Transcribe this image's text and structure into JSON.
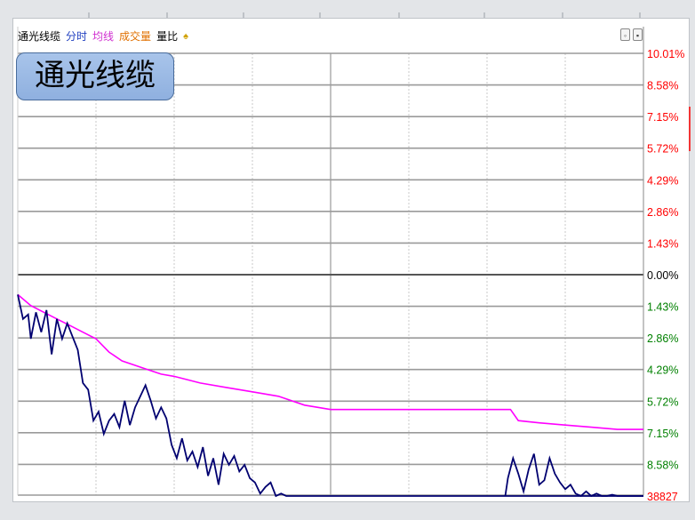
{
  "header": {
    "stock_label": "通光线缆",
    "time_label": "分时",
    "avg_label": "均线",
    "volume_label": "成交量",
    "ratio_label": "量比",
    "bell_icon": "bell-icon",
    "zoom_icon": "zoom-icon",
    "menu_icon": "menu-icon"
  },
  "title_badge": "通光线缆",
  "bottom_right_value": "38827",
  "colors": {
    "price_line": "#000070",
    "avg_line": "#ff00ff",
    "positive": "#ff0000",
    "negative": "#008000",
    "baseline": "#000000"
  },
  "chart_data": {
    "type": "line",
    "title": "",
    "xlabel": "",
    "ylabel": "",
    "y_ticks_right": [
      {
        "label": "10.01%",
        "value": 10.01,
        "sign": "up"
      },
      {
        "label": "8.58%",
        "value": 8.58,
        "sign": "up"
      },
      {
        "label": "7.15%",
        "value": 7.15,
        "sign": "up"
      },
      {
        "label": "5.72%",
        "value": 5.72,
        "sign": "up"
      },
      {
        "label": "4.29%",
        "value": 4.29,
        "sign": "up"
      },
      {
        "label": "2.86%",
        "value": 2.86,
        "sign": "up"
      },
      {
        "label": "1.43%",
        "value": 1.43,
        "sign": "up"
      },
      {
        "label": "0.00%",
        "value": 0.0,
        "sign": "zero"
      },
      {
        "label": "1.43%",
        "value": -1.43,
        "sign": "down"
      },
      {
        "label": "2.86%",
        "value": -2.86,
        "sign": "down"
      },
      {
        "label": "4.29%",
        "value": -4.29,
        "sign": "down"
      },
      {
        "label": "5.72%",
        "value": -5.72,
        "sign": "down"
      },
      {
        "label": "7.15%",
        "value": -7.15,
        "sign": "down"
      },
      {
        "label": "8.58%",
        "value": -8.58,
        "sign": "down"
      }
    ],
    "ylim": [
      -10.01,
      10.01
    ],
    "xlim": [
      0,
      240
    ],
    "grid": true,
    "series": [
      {
        "key": "price",
        "x": [
          0,
          2,
          4,
          5,
          7,
          9,
          11,
          13,
          15,
          17,
          19,
          21,
          23,
          25,
          27,
          29,
          31,
          33,
          35,
          37,
          39,
          41,
          43,
          45,
          47,
          49,
          51,
          53,
          55,
          57,
          59,
          61,
          63,
          65,
          67,
          69,
          71,
          73,
          75,
          77,
          79,
          81,
          83,
          85,
          87,
          89,
          91,
          93,
          95,
          97,
          99,
          101,
          103,
          105,
          107,
          110,
          240
        ],
        "values": [
          -0.9,
          -2.0,
          -1.8,
          -2.9,
          -1.7,
          -2.6,
          -1.6,
          -3.6,
          -2.0,
          -2.9,
          -2.2,
          -2.8,
          -3.4,
          -4.9,
          -5.2,
          -6.6,
          -6.2,
          -7.2,
          -6.6,
          -6.3,
          -6.9,
          -5.7,
          -6.8,
          -6.0,
          -5.5,
          -5.0,
          -5.7,
          -6.5,
          -6.0,
          -6.5,
          -7.7,
          -8.3,
          -7.4,
          -8.4,
          -8.0,
          -8.7,
          -7.8,
          -9.1,
          -8.3,
          -9.5,
          -8.1,
          -8.6,
          -8.2,
          -8.9,
          -8.6,
          -9.2,
          -9.4,
          -9.9,
          -9.6,
          -9.4,
          -10.01,
          -9.9,
          -10.01,
          -10.01,
          -10.01,
          -10.01,
          -10.01
        ]
      },
      {
        "key": "avg",
        "x": [
          0,
          5,
          10,
          15,
          20,
          25,
          30,
          35,
          40,
          45,
          50,
          55,
          60,
          70,
          80,
          90,
          100,
          110,
          120,
          150,
          165,
          180,
          189,
          192,
          200,
          210,
          220,
          230,
          240
        ],
        "values": [
          -0.9,
          -1.4,
          -1.7,
          -2.0,
          -2.3,
          -2.6,
          -2.9,
          -3.5,
          -3.9,
          -4.1,
          -4.3,
          -4.5,
          -4.6,
          -4.9,
          -5.1,
          -5.3,
          -5.5,
          -5.9,
          -6.1,
          -6.1,
          -6.1,
          -6.1,
          -6.1,
          -6.6,
          -6.7,
          -6.8,
          -6.9,
          -7.0,
          -7.0
        ]
      }
    ],
    "price_recovery": {
      "x": [
        187,
        188,
        190,
        192,
        194,
        196,
        198,
        200,
        202,
        204,
        206,
        208,
        210,
        212,
        214,
        216,
        218,
        220,
        222,
        224,
        226,
        228,
        230,
        240
      ],
      "values": [
        -10.01,
        -9.2,
        -8.3,
        -9.0,
        -9.8,
        -8.8,
        -8.1,
        -9.5,
        -9.3,
        -8.3,
        -9.0,
        -9.4,
        -9.7,
        -9.5,
        -9.9,
        -10.01,
        -9.8,
        -10.01,
        -9.9,
        -10.01,
        -10.01,
        -9.95,
        -10.01,
        -10.01
      ]
    }
  }
}
